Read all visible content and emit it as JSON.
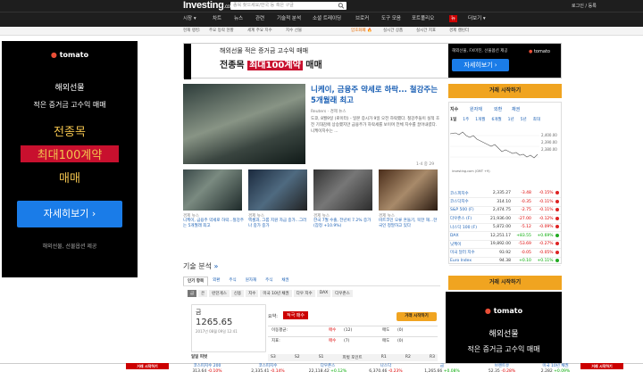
{
  "header": {
    "logo": "Investing",
    "logo_suffix": ".com",
    "search_placeholder": "종목 찾으세요/한국 등 혹은 구글",
    "login": "로그인 / 등록"
  },
  "nav": [
    "시장 ▾",
    "차트",
    "뉴스",
    "관련",
    "기술적 분석",
    "소셜 트레이딩",
    "브로커",
    "도구 모음",
    "포트폴리오",
    "뉴",
    "더보기 ▾"
  ],
  "subnav": [
    "현재 랭킹:",
    "주요 등락 현황",
    "세계 주요 지수",
    "지수 선물",
    "암호화폐",
    "실시간 상품",
    "실시간 지표",
    "경제 캘린더"
  ],
  "subnav_hot": "암호화폐 🔥",
  "left_ad": {
    "brand": "tomato",
    "line1": "해외선물",
    "line2": "적은 증거금 고수익 매매",
    "line3": "전종목",
    "line4": "최대100계약",
    "line5": "매매",
    "button": "자세히보기 ›",
    "footer": "해외선물, 선물옵션 제공"
  },
  "top_ad": {
    "line1": "해외선물 적은 증거금 고수익 매매",
    "line2a": "전종목 ",
    "line2b": "최대100계약",
    "line2c": " 매매",
    "right": "해외선물, FX마진, 선물옵션 제공",
    "button": "자세히보기 ›",
    "brand": "tomato"
  },
  "news_main": {
    "title": "니케이, 금융주 약세로 하락... 철강주는 5개월래 최고",
    "source": "Reuters",
    "meta": " · 경제 뉴스",
    "body": "도쿄, 8월9일 (로이터) - 일본 증시가 9일 오전 하락했다. 철강주들이 실적 호전 기대감에 상승했지만 금융주가 하락세를 보이며 전체 지수를 끌어내렸다. 니케이지수는 ...",
    "counter": "1-4 중 29"
  },
  "news_thumbs": [
    {
      "source": "경제 뉴스",
      "title": "니케이, 금융주 약세로 하락...철강주는 5개월래 최고"
    },
    {
      "source": "경제 뉴스",
      "title": "엑셀과, 그룹 지원 자금 중가...그러나 중가 중가"
    },
    {
      "source": "경제 뉴스",
      "title": "한국 7월 수출, 전년비 7.2% 증가 (잠정 +10.9%)"
    },
    {
      "source": "경제 뉴스",
      "title": "비트코인 오류 흔들기, 북한 해...한국인 정말하고 있다"
    }
  ],
  "market_widget": {
    "button": "거래 시작하기",
    "tabs": [
      "지수",
      "원자재",
      "외환",
      "채권"
    ],
    "ranges": [
      "1일",
      "1주",
      "1개월",
      "6개월",
      "1년",
      "5년",
      "최대"
    ],
    "chart_source": "investing.com (GMT +9)",
    "y_labels": [
      "2,400.00",
      "2,390.00",
      "2,380.00"
    ],
    "rows": [
      [
        "코스피지수",
        "2,335.27",
        "-3.48",
        "-0.15%",
        "red"
      ],
      [
        "코스닥지수",
        "314.10",
        "-0.35",
        "-0.11%",
        "red"
      ],
      [
        "S&P 500 (F)",
        "2,474.75",
        "-2.75",
        "-0.11%",
        "red"
      ],
      [
        "다우존스 (F)",
        "21,936.00",
        "-27.00",
        "-0.12%",
        "red"
      ],
      [
        "나스닥 100 (F)",
        "5,872.00",
        "-5.12",
        "-0.09%",
        "red"
      ],
      [
        "DAX",
        "12,251.17",
        "+83.55",
        "+0.69%",
        "grn"
      ],
      [
        "닛케이",
        "19,892.00",
        "-53.69",
        "-0.27%",
        "red"
      ],
      [
        "미국 달러 지수",
        "93.92",
        "-0.05",
        "-0.05%",
        "red"
      ],
      [
        "Euro Index",
        "94.38",
        "+0.10",
        "+0.11%",
        "grn"
      ]
    ]
  },
  "tech": {
    "title": "기술 분석",
    "arrow": "»",
    "tabs": [
      "인기 항목",
      "외환",
      "주식",
      "원자재",
      "주식",
      "채권"
    ],
    "sub": [
      "금",
      "은",
      "런던게스",
      "신용",
      "지수",
      "미국 10년 채권",
      "다우 지수",
      "DAX",
      "다우존스"
    ],
    "asset": "금",
    "price": "1265.65",
    "time": "2017년 08월 09일 12:41",
    "summary_label": "요약:",
    "summary_val": "적극 매수",
    "trade_btn": "거래 시작하기",
    "rows": [
      [
        "이동평균:",
        "매수",
        "(12)",
        "매도",
        "(0)"
      ],
      [
        "지표:",
        "매수",
        "(7)",
        "매도",
        "(0)"
      ]
    ],
    "pivot": "피벗 포인트",
    "pivots": [
      "S3",
      "S2",
      "S1",
      "피벗 포인트",
      "R1",
      "R2",
      "R3"
    ],
    "period": "일일 피벗"
  },
  "ticker": [
    [
      "코스피지수 200",
      "313.64",
      "-0.10%"
    ],
    [
      "코스피지수",
      "2,335.41",
      "-0.14%"
    ],
    [
      "다우존스",
      "22,118.42",
      "+0.12%"
    ],
    [
      "나스닥",
      "6,370.46",
      "-0.23%"
    ],
    [
      "금",
      "1,265.66",
      "+0.08%"
    ],
    [
      "브렌트유",
      "52.35",
      "-0.28%"
    ],
    [
      "미국 10년 채권",
      "2.282",
      "+0.09%"
    ]
  ],
  "ticker_trade": "거래 시작하기",
  "right_ad": {
    "brand": "tomato",
    "line1": "해외선물",
    "line2": "적은 증거금 고수익 매매"
  }
}
